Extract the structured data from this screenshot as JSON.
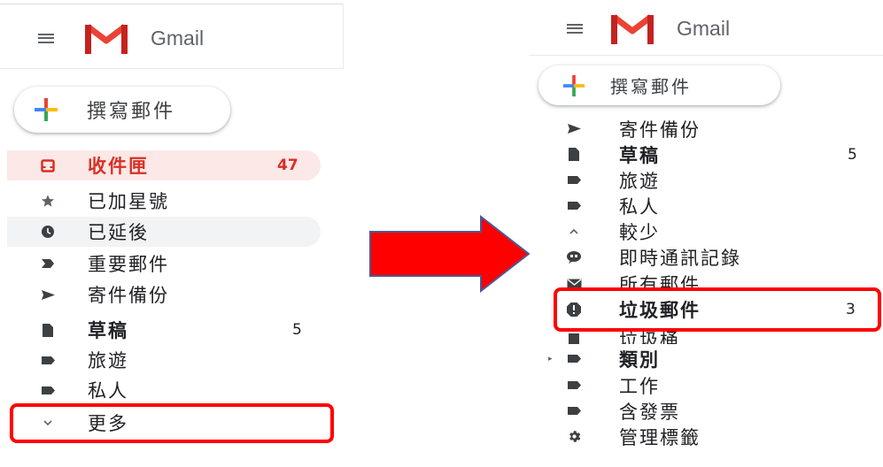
{
  "left": {
    "brand": "Gmail",
    "compose_label": "撰寫郵件",
    "items": [
      {
        "icon": "inbox-icon",
        "label": "收件匣",
        "count": "47"
      },
      {
        "icon": "star-icon",
        "label": "已加星號",
        "count": ""
      },
      {
        "icon": "clock-icon",
        "label": "已延後",
        "count": ""
      },
      {
        "icon": "important-icon",
        "label": "重要郵件",
        "count": ""
      },
      {
        "icon": "send-icon",
        "label": "寄件備份",
        "count": ""
      },
      {
        "icon": "draft-icon",
        "label": "草稿",
        "count": "5"
      },
      {
        "icon": "label-icon",
        "label": "旅遊",
        "count": ""
      },
      {
        "icon": "label-icon",
        "label": "私人",
        "count": ""
      },
      {
        "icon": "chevron-down-icon",
        "label": "更多",
        "count": ""
      }
    ]
  },
  "right": {
    "brand": "Gmail",
    "compose_label": "撰寫郵件",
    "items": [
      {
        "icon": "send-icon",
        "label": "寄件備份",
        "count": ""
      },
      {
        "icon": "draft-icon",
        "label": "草稿",
        "count": "5"
      },
      {
        "icon": "label-icon",
        "label": "旅遊",
        "count": ""
      },
      {
        "icon": "label-icon",
        "label": "私人",
        "count": ""
      },
      {
        "icon": "chevron-up-icon",
        "label": "較少",
        "count": ""
      },
      {
        "icon": "chat-icon",
        "label": "即時通訊記錄",
        "count": ""
      },
      {
        "icon": "mail-icon",
        "label": "所有郵件",
        "count": ""
      },
      {
        "icon": "spam-icon",
        "label": "垃圾郵件",
        "count": "3"
      },
      {
        "icon": "trash-icon",
        "label": "垃圾桶",
        "count": ""
      },
      {
        "icon": "label-icon",
        "label": "類別",
        "count": ""
      },
      {
        "icon": "label-icon",
        "label": "工作",
        "count": ""
      },
      {
        "icon": "label-icon",
        "label": "含發票",
        "count": ""
      },
      {
        "icon": "gear-icon",
        "label": "管理標籤",
        "count": ""
      }
    ]
  },
  "colors": {
    "inbox_accent": "#d93025",
    "inbox_bg": "#fce8e6",
    "hover_bg": "#f1f3f4",
    "highlight": "#ff0000"
  }
}
